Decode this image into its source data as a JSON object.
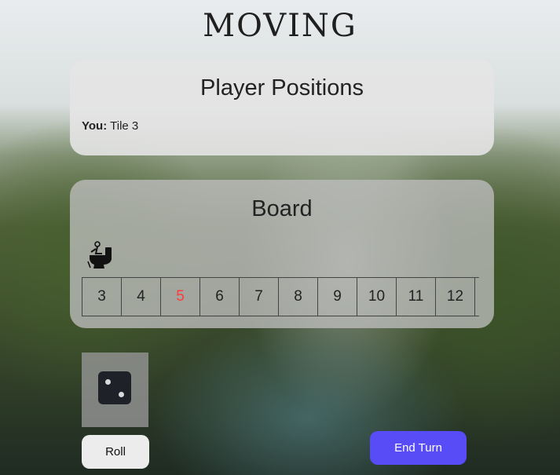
{
  "app": {
    "title": "MOVING"
  },
  "positions": {
    "heading": "Player Positions",
    "players": [
      {
        "name": "You:",
        "location": "Tile 3"
      }
    ]
  },
  "board": {
    "heading": "Board",
    "piece_icon": "person-on-toilet-icon",
    "tiles": [
      "3",
      "4",
      "5",
      "6",
      "7",
      "8",
      "9",
      "10",
      "11",
      "12"
    ],
    "highlighted_tile": "5",
    "highlight_color": "#ff3b3b"
  },
  "dice": {
    "face": 2,
    "icon": "dice-two-icon"
  },
  "controls": {
    "roll_label": "Roll",
    "end_turn_label": "End Turn",
    "end_turn_color": "#574cf5"
  }
}
